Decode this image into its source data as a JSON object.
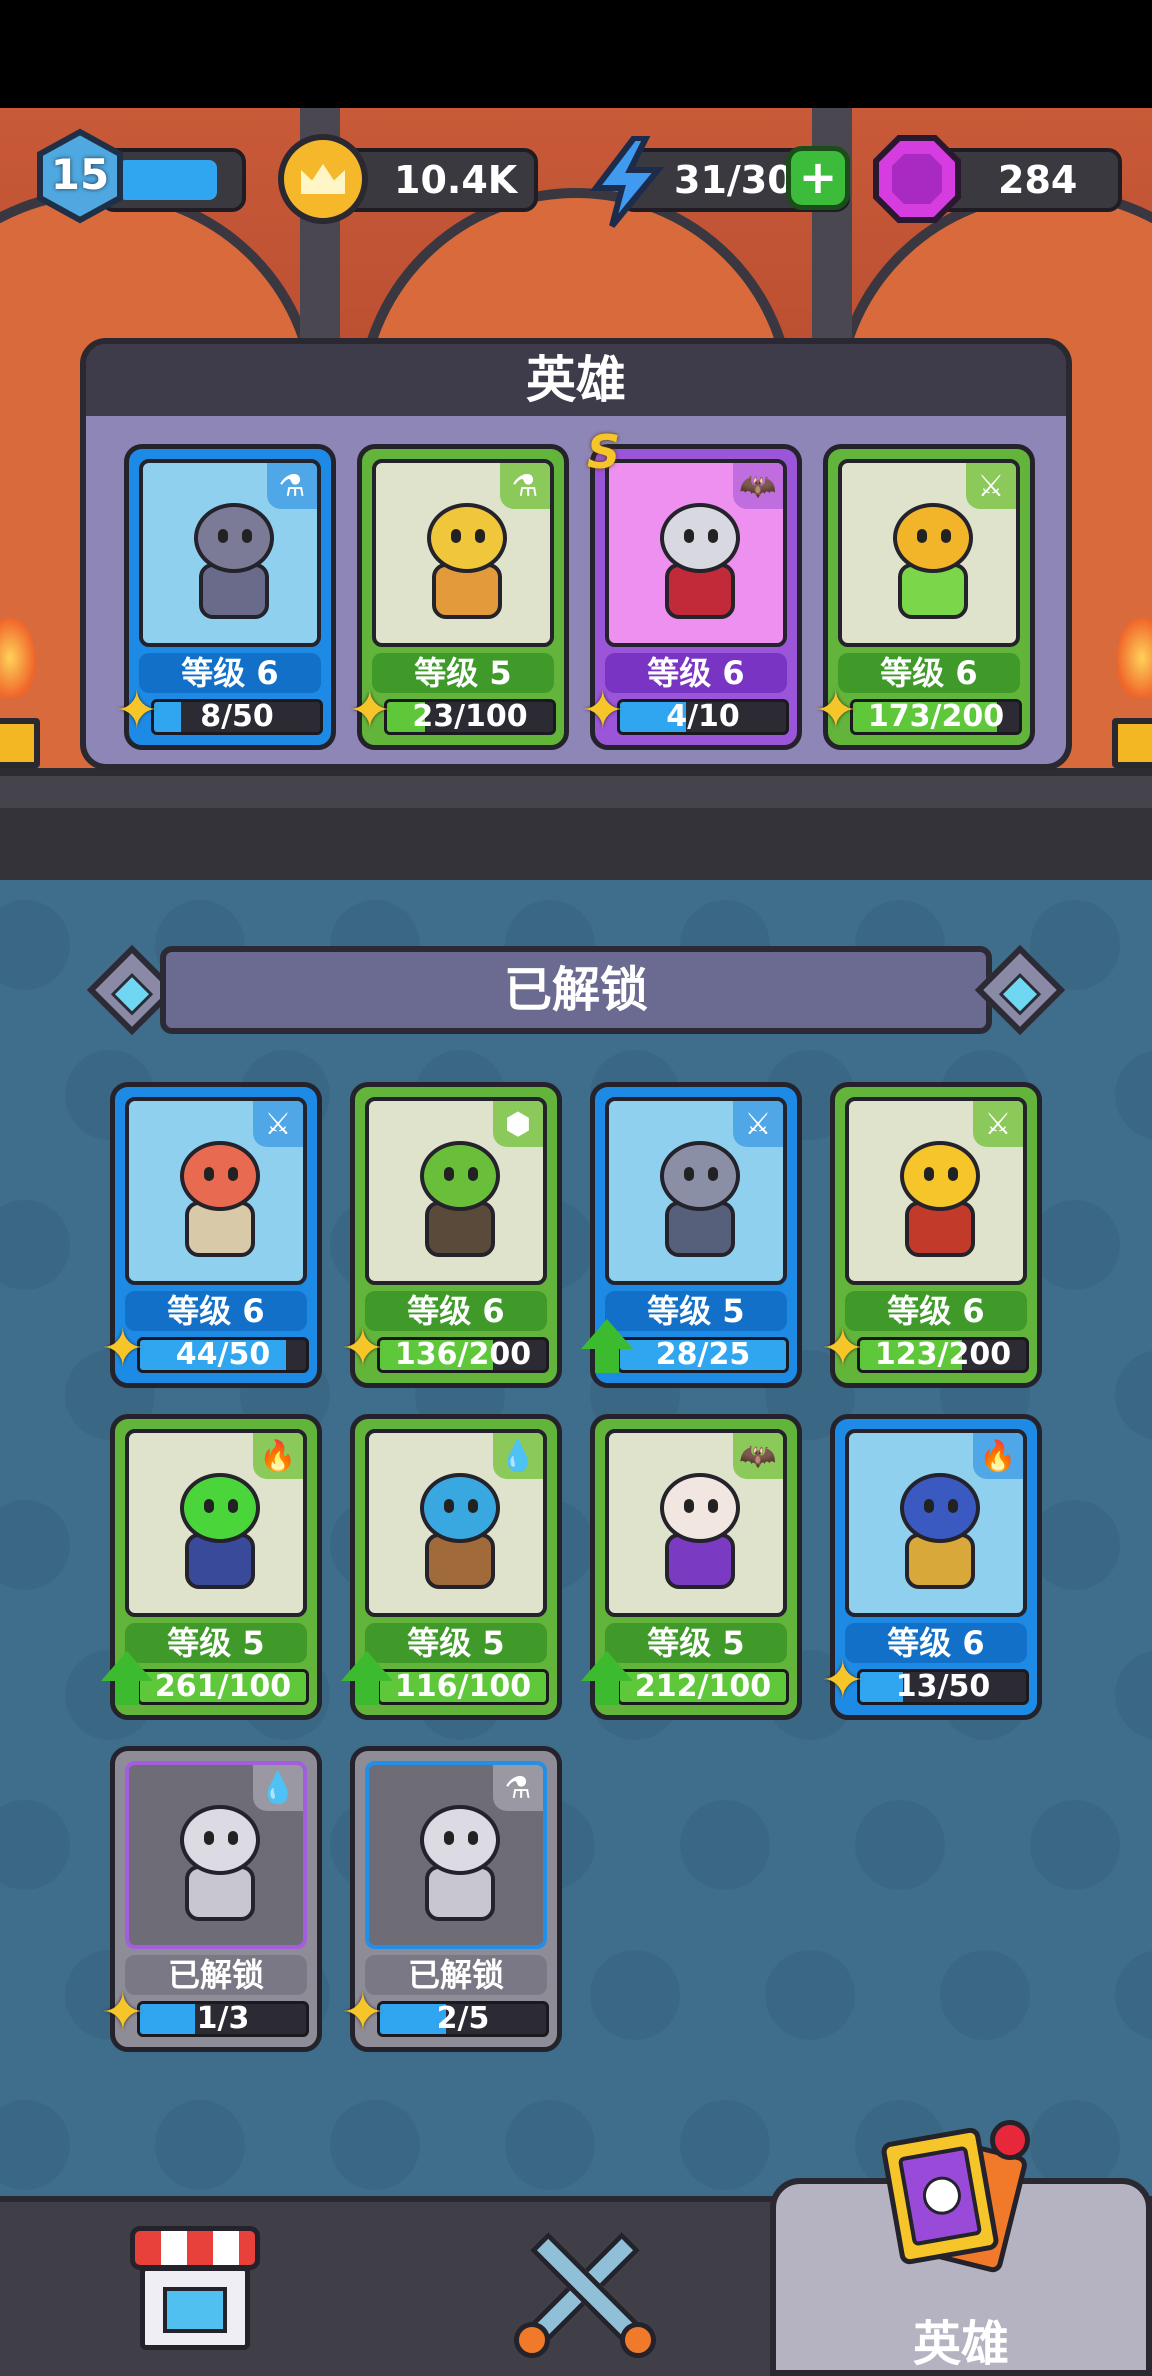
{
  "top_bar": {
    "player_level": "15",
    "level_progress": 0.85,
    "coins": "10.4K",
    "energy": "31/30",
    "gems": "284"
  },
  "team": {
    "title": "英雄",
    "heroes": [
      {
        "level": "等级 6",
        "progress": "8/50",
        "ratio": 0.16,
        "rarity": "blue",
        "badge": "potion",
        "body": "#6a6a8a",
        "head": "#7b7b98"
      },
      {
        "level": "等级 5",
        "progress": "23/100",
        "ratio": 0.23,
        "rarity": "green",
        "badge": "potion",
        "body": "#e39a3a",
        "head": "#f0c63a"
      },
      {
        "level": "等级 6",
        "progress": "4/10",
        "ratio": 0.4,
        "rarity": "purple",
        "badge": "bat",
        "tag": "S",
        "body": "#c22a3a",
        "head": "#d8d8e0"
      },
      {
        "level": "等级 6",
        "progress": "173/200",
        "ratio": 0.865,
        "rarity": "green",
        "badge": "sword",
        "body": "#7cd64a",
        "head": "#f2b52a"
      }
    ]
  },
  "unlocked": {
    "title": "已解锁",
    "heroes": [
      {
        "level": "等级 6",
        "progress": "44/50",
        "ratio": 0.88,
        "rarity": "blue",
        "badge": "sword",
        "icon": "puzzle",
        "body": "#d8c9a8",
        "head": "#e86a50"
      },
      {
        "level": "等级 6",
        "progress": "136/200",
        "ratio": 0.68,
        "rarity": "green",
        "badge": "rock",
        "icon": "puzzle",
        "body": "#5a4a3a",
        "head": "#6abf3a"
      },
      {
        "level": "等级 5",
        "progress": "28/25",
        "ratio": 1.0,
        "rarity": "blue",
        "badge": "sword",
        "icon": "arrow",
        "body": "#56607a",
        "head": "#8a8fa5"
      },
      {
        "level": "等级 6",
        "progress": "123/200",
        "ratio": 0.615,
        "rarity": "green",
        "badge": "sword",
        "icon": "puzzle",
        "body": "#c23a2a",
        "head": "#f5c52a"
      },
      {
        "level": "等级 5",
        "progress": "261/100",
        "ratio": 1.0,
        "rarity": "green",
        "badge": "fire",
        "icon": "arrow",
        "body": "#3a4a9a",
        "head": "#4ad63a"
      },
      {
        "level": "等级 5",
        "progress": "116/100",
        "ratio": 1.0,
        "rarity": "green",
        "badge": "drop",
        "icon": "arrow",
        "body": "#a06a3a",
        "head": "#3aa8e0"
      },
      {
        "level": "等级 5",
        "progress": "212/100",
        "ratio": 1.0,
        "rarity": "green",
        "badge": "bat",
        "icon": "arrow",
        "body": "#7a3ac2",
        "head": "#f2e6e0"
      },
      {
        "level": "等级 6",
        "progress": "13/50",
        "ratio": 0.26,
        "rarity": "blue",
        "badge": "fire",
        "icon": "puzzle",
        "body": "#d8a83a",
        "head": "#3a5ac2"
      }
    ],
    "locked": [
      {
        "label": "已解锁",
        "progress": "1/3",
        "ratio": 0.33,
        "edge": "purple",
        "badge": "drop"
      },
      {
        "label": "已解锁",
        "progress": "2/5",
        "ratio": 0.4,
        "edge": "blue",
        "badge": "potion"
      }
    ]
  },
  "nav": {
    "shop_icon": "shop-icon",
    "battle_icon": "crossed-swords-icon",
    "heroes_label": "英雄"
  },
  "colors": {
    "accent_blue": "#1d8be6",
    "accent_green": "#63b43a",
    "accent_purple": "#9a55d8",
    "section_bg": "#3f6e8c"
  }
}
